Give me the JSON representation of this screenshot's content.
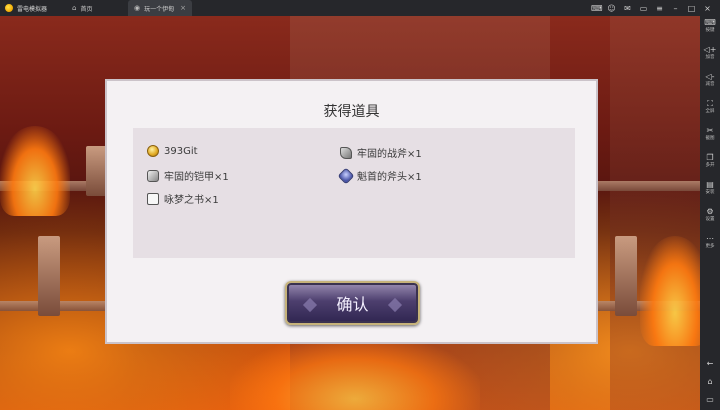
{
  "app": {
    "title": "雷电模拟器"
  },
  "tabs": [
    {
      "label": "首页",
      "icon": "home-icon"
    },
    {
      "label": "玩一个伊甸",
      "icon": "gamepad-icon"
    }
  ],
  "sidebar": {
    "items": [
      {
        "label": "按键",
        "icon": "keyboard-icon"
      },
      {
        "label": "加音",
        "icon": "volume-up-icon"
      },
      {
        "label": "减音",
        "icon": "volume-down-icon"
      },
      {
        "label": "全屏",
        "icon": "fullscreen-icon"
      },
      {
        "label": "截图",
        "icon": "scissors-icon"
      },
      {
        "label": "多开",
        "icon": "multi-window-icon"
      },
      {
        "label": "安装",
        "icon": "install-icon"
      },
      {
        "label": "设置",
        "icon": "gear-icon"
      },
      {
        "label": "更多",
        "icon": "more-icon"
      }
    ]
  },
  "dialog": {
    "title": "获得道具",
    "items": [
      {
        "text": "393Git",
        "icon": "coin-icon"
      },
      {
        "text": "牢固的战斧×1",
        "icon": "axe-icon"
      },
      {
        "text": "牢固的铠甲×1",
        "icon": "armor-icon"
      },
      {
        "text": "魁首的斧头×1",
        "icon": "axe-head-icon"
      },
      {
        "text": "咏梦之书×1",
        "icon": "book-icon"
      }
    ],
    "confirm_label": "确认"
  }
}
